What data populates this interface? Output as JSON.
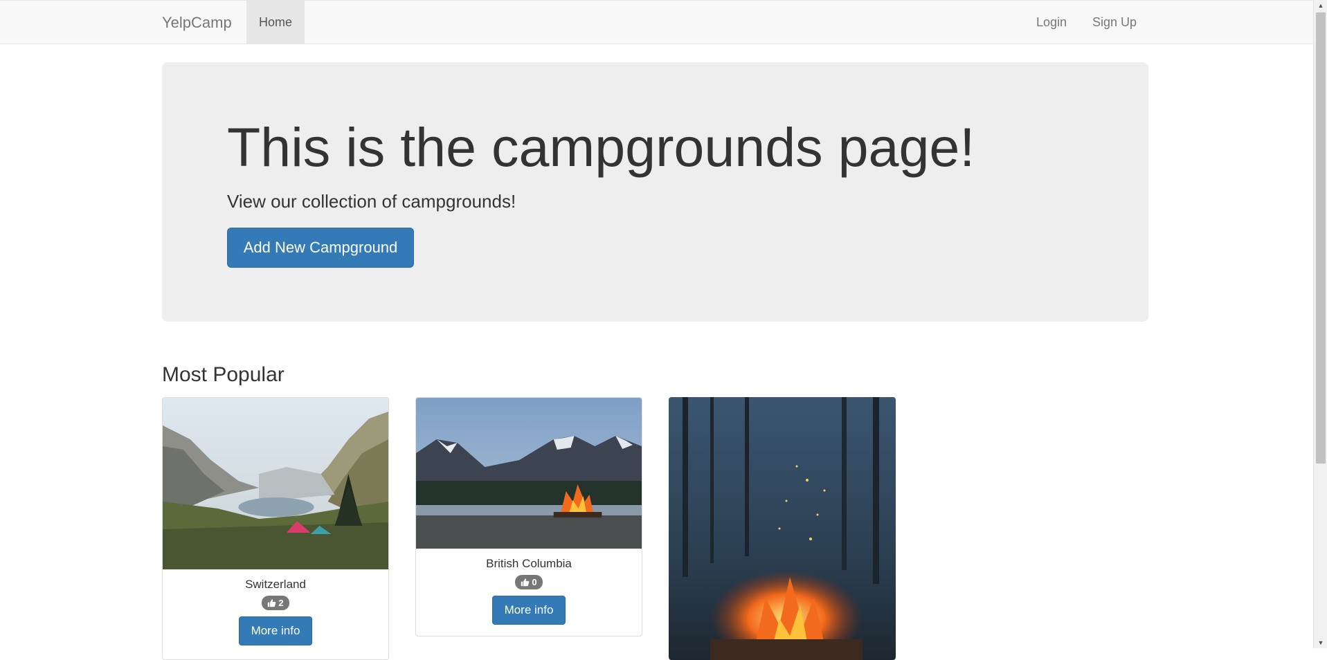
{
  "navbar": {
    "brand": "YelpCamp",
    "home": "Home",
    "login": "Login",
    "signup": "Sign Up"
  },
  "jumbotron": {
    "title": "This is the campgrounds page!",
    "subtitle": "View our collection of campgrounds!",
    "add_button": "Add New Campground"
  },
  "section": {
    "title": "Most Popular"
  },
  "campgrounds": [
    {
      "name": "Switzerland",
      "likes": "2",
      "button": "More info"
    },
    {
      "name": "British Columbia",
      "likes": "0",
      "button": "More info"
    },
    {
      "name": "",
      "likes": "",
      "button": ""
    }
  ],
  "colors": {
    "primary": "#337ab7",
    "navbar_bg": "#f8f8f8",
    "jumbotron_bg": "#eeeeee",
    "badge_bg": "#777777"
  }
}
